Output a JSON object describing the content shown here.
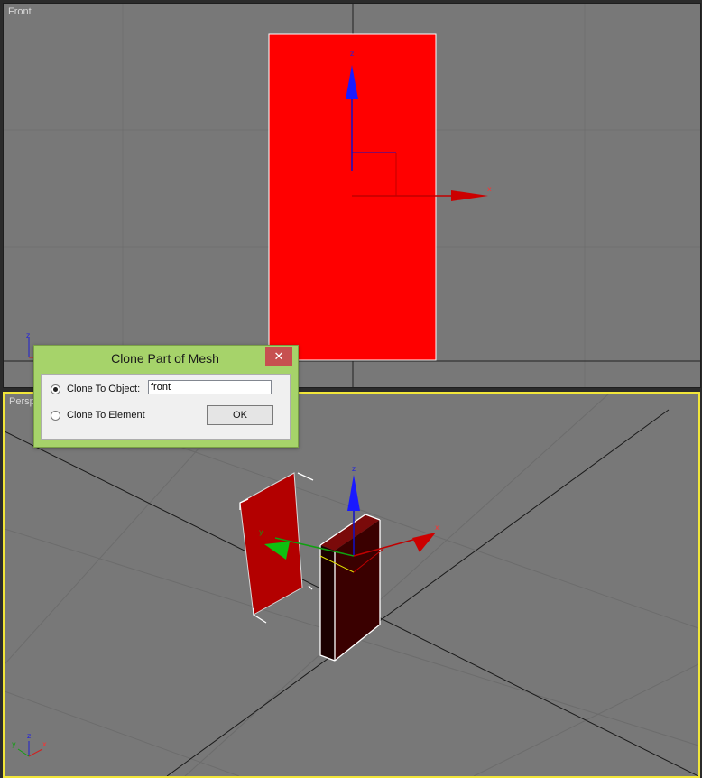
{
  "viewports": {
    "front": {
      "label": "Front"
    },
    "perspective": {
      "label": "Perspective",
      "label_visible": "Persp"
    }
  },
  "gizmo": {
    "x": "x",
    "y": "y",
    "z": "z"
  },
  "dialog": {
    "title": "Clone Part of Mesh",
    "close": "✕",
    "options": [
      {
        "label": "Clone To Object:",
        "selected": true
      },
      {
        "label": "Clone To Element",
        "selected": false
      }
    ],
    "object_name": "front",
    "ok": "OK"
  },
  "colors": {
    "viewport_bg": "#787878",
    "active_border": "#f2e63a",
    "object_red": "#ff0000",
    "dialog_frame": "#a6d36a"
  }
}
